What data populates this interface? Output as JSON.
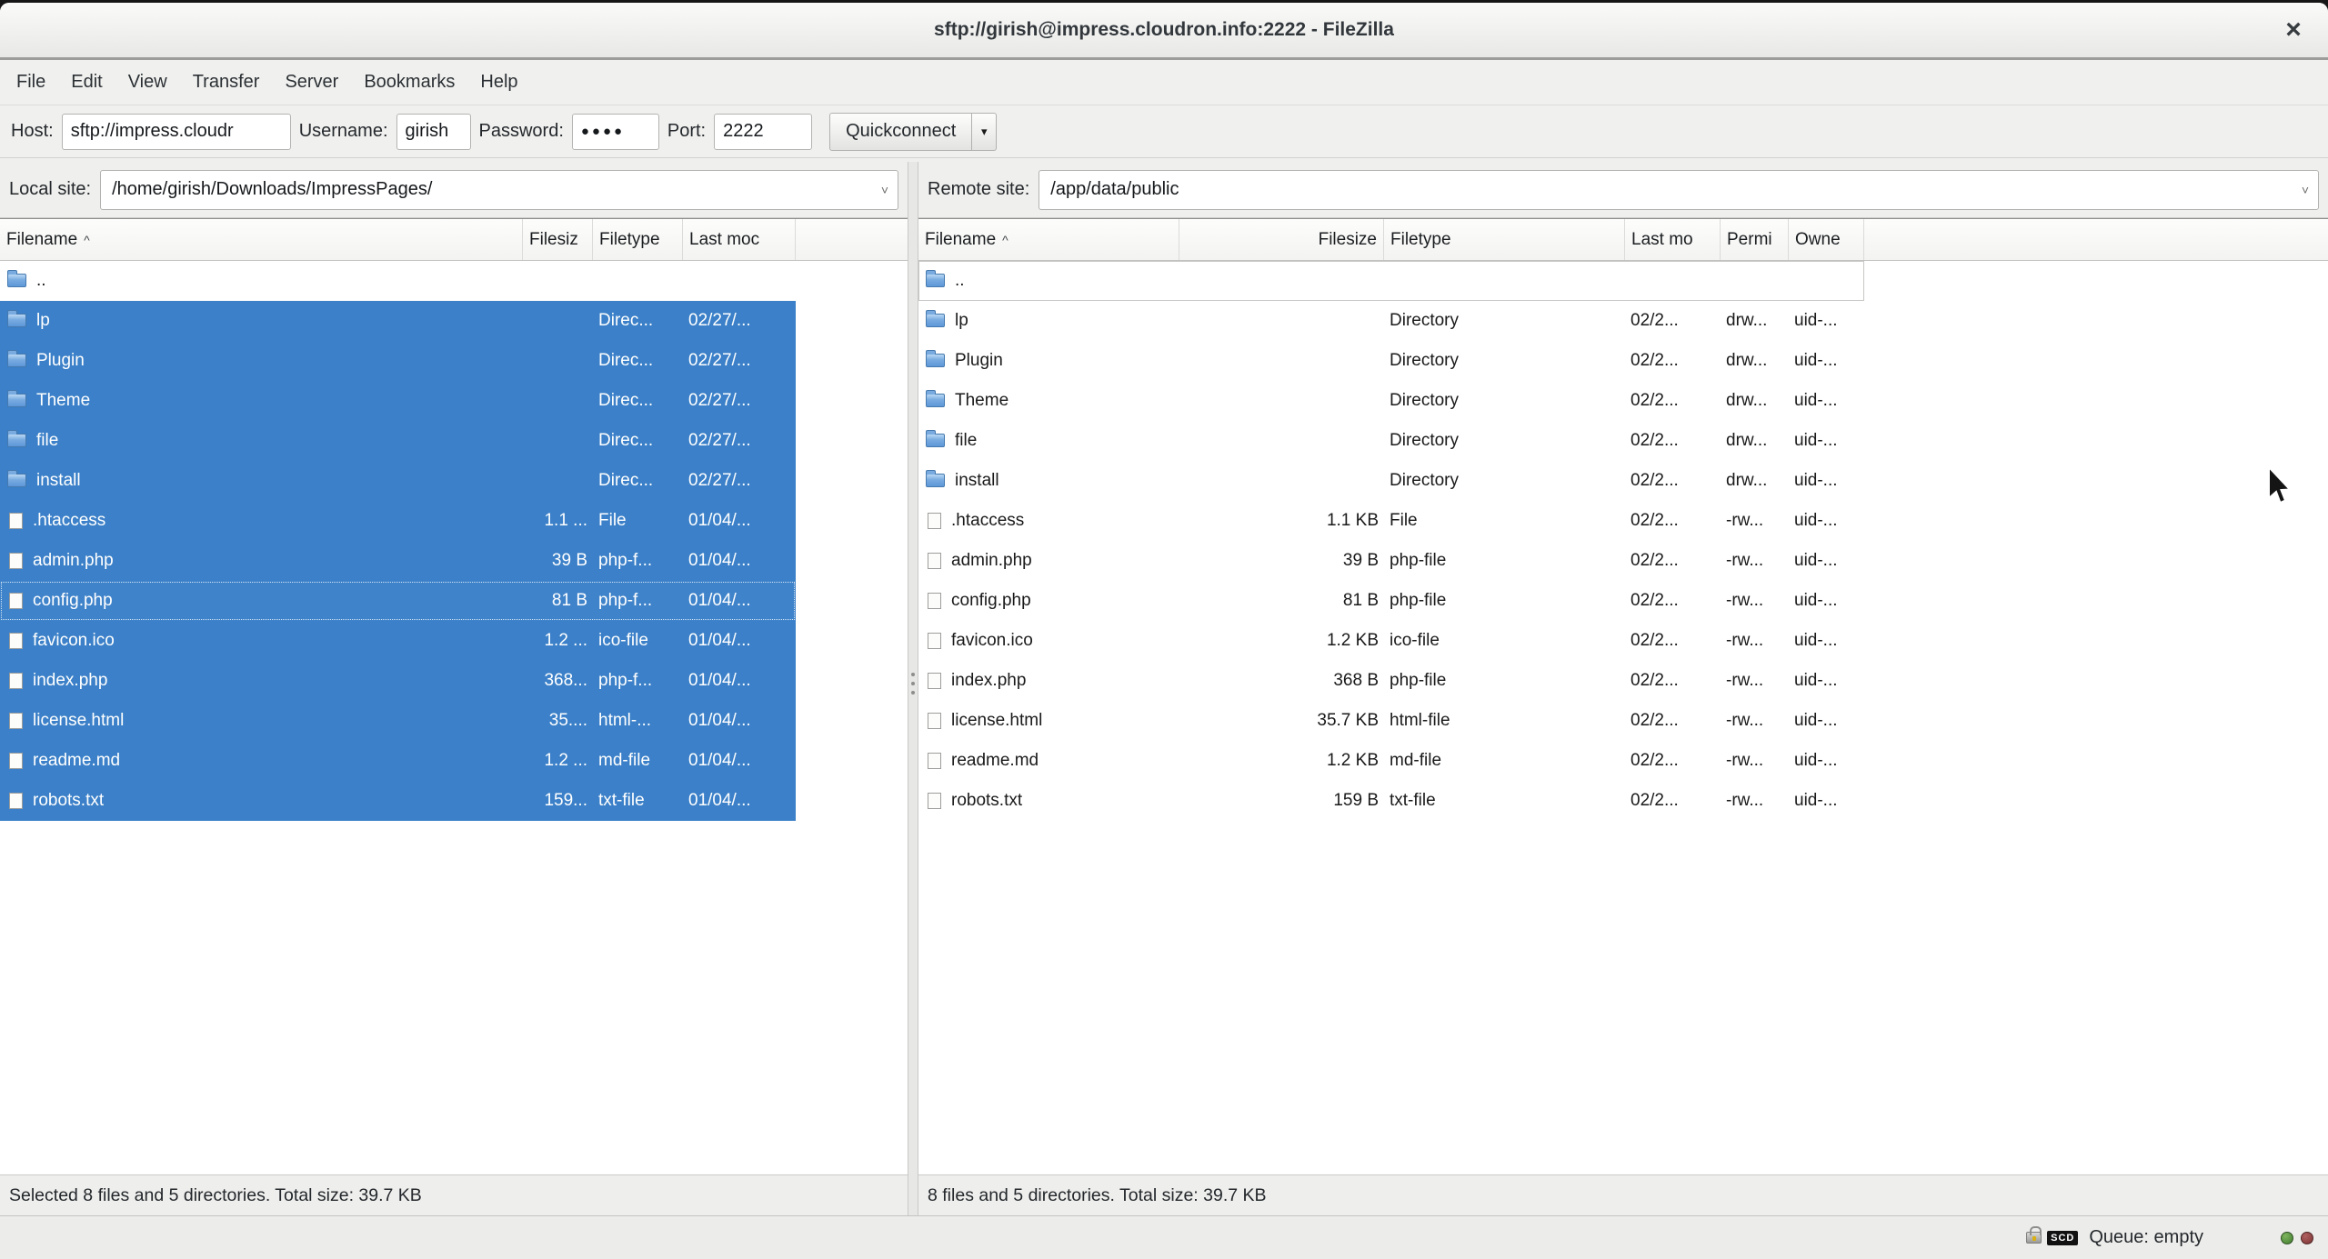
{
  "window": {
    "title": "sftp://girish@impress.cloudron.info:2222 - FileZilla",
    "close_glyph": "×"
  },
  "menubar": {
    "items": [
      "File",
      "Edit",
      "View",
      "Transfer",
      "Server",
      "Bookmarks",
      "Help"
    ]
  },
  "quickconnect": {
    "host_label": "Host:",
    "host_value": "sftp://impress.cloudr",
    "username_label": "Username:",
    "username_value": "girish",
    "password_label": "Password:",
    "password_value": "●●●●",
    "port_label": "Port:",
    "port_value": "2222",
    "button_label": "Quickconnect",
    "dropdown_glyph": "▾"
  },
  "local": {
    "site_label": "Local site:",
    "site_value": "/home/girish/Downloads/ImpressPages/",
    "combo_arrow": "˅",
    "columns": [
      "Filename",
      "Filesiz",
      "Filetype",
      "Last moc"
    ],
    "sort_caret": "^",
    "rows": [
      {
        "name": "..",
        "kind": "dir",
        "size": "",
        "type": "",
        "modified": ""
      },
      {
        "name": "lp",
        "kind": "dir",
        "size": "",
        "type": "Direc...",
        "modified": "02/27/...",
        "selected": true
      },
      {
        "name": "Plugin",
        "kind": "dir",
        "size": "",
        "type": "Direc...",
        "modified": "02/27/...",
        "selected": true
      },
      {
        "name": "Theme",
        "kind": "dir",
        "size": "",
        "type": "Direc...",
        "modified": "02/27/...",
        "selected": true
      },
      {
        "name": "file",
        "kind": "dir",
        "size": "",
        "type": "Direc...",
        "modified": "02/27/...",
        "selected": true
      },
      {
        "name": "install",
        "kind": "dir",
        "size": "",
        "type": "Direc...",
        "modified": "02/27/...",
        "selected": true
      },
      {
        "name": ".htaccess",
        "kind": "file",
        "size": "1.1 ...",
        "type": "File",
        "modified": "01/04/...",
        "selected": true
      },
      {
        "name": "admin.php",
        "kind": "file",
        "size": "39 B",
        "type": "php-f...",
        "modified": "01/04/...",
        "selected": true
      },
      {
        "name": "config.php",
        "kind": "file",
        "size": "81 B",
        "type": "php-f...",
        "modified": "01/04/...",
        "selected": true,
        "focused": true
      },
      {
        "name": "favicon.ico",
        "kind": "file",
        "size": "1.2 ...",
        "type": "ico-file",
        "modified": "01/04/...",
        "selected": true
      },
      {
        "name": "index.php",
        "kind": "file",
        "size": "368...",
        "type": "php-f...",
        "modified": "01/04/...",
        "selected": true
      },
      {
        "name": "license.html",
        "kind": "file",
        "size": "35....",
        "type": "html-...",
        "modified": "01/04/...",
        "selected": true
      },
      {
        "name": "readme.md",
        "kind": "file",
        "size": "1.2 ...",
        "type": "md-file",
        "modified": "01/04/...",
        "selected": true
      },
      {
        "name": "robots.txt",
        "kind": "file",
        "size": "159...",
        "type": "txt-file",
        "modified": "01/04/...",
        "selected": true
      }
    ],
    "status": "Selected 8 files and 5 directories. Total size: 39.7 KB"
  },
  "remote": {
    "site_label": "Remote site:",
    "site_value": "/app/data/public",
    "combo_arrow": "˅",
    "columns": [
      "Filename",
      "Filesize",
      "Filetype",
      "Last mo",
      "Permi",
      "Owne"
    ],
    "sort_caret": "^",
    "rows": [
      {
        "name": "..",
        "kind": "dir",
        "size": "",
        "type": "",
        "modified": "",
        "perms": "",
        "owner": "",
        "focused": true
      },
      {
        "name": "lp",
        "kind": "dir",
        "size": "",
        "type": "Directory",
        "modified": "02/2...",
        "perms": "drw...",
        "owner": "uid-..."
      },
      {
        "name": "Plugin",
        "kind": "dir",
        "size": "",
        "type": "Directory",
        "modified": "02/2...",
        "perms": "drw...",
        "owner": "uid-..."
      },
      {
        "name": "Theme",
        "kind": "dir",
        "size": "",
        "type": "Directory",
        "modified": "02/2...",
        "perms": "drw...",
        "owner": "uid-..."
      },
      {
        "name": "file",
        "kind": "dir",
        "size": "",
        "type": "Directory",
        "modified": "02/2...",
        "perms": "drw...",
        "owner": "uid-..."
      },
      {
        "name": "install",
        "kind": "dir",
        "size": "",
        "type": "Directory",
        "modified": "02/2...",
        "perms": "drw...",
        "owner": "uid-..."
      },
      {
        "name": ".htaccess",
        "kind": "file",
        "size": "1.1 KB",
        "type": "File",
        "modified": "02/2...",
        "perms": "-rw...",
        "owner": "uid-..."
      },
      {
        "name": "admin.php",
        "kind": "file",
        "size": "39 B",
        "type": "php-file",
        "modified": "02/2...",
        "perms": "-rw...",
        "owner": "uid-..."
      },
      {
        "name": "config.php",
        "kind": "file",
        "size": "81 B",
        "type": "php-file",
        "modified": "02/2...",
        "perms": "-rw...",
        "owner": "uid-..."
      },
      {
        "name": "favicon.ico",
        "kind": "file",
        "size": "1.2 KB",
        "type": "ico-file",
        "modified": "02/2...",
        "perms": "-rw...",
        "owner": "uid-..."
      },
      {
        "name": "index.php",
        "kind": "file",
        "size": "368 B",
        "type": "php-file",
        "modified": "02/2...",
        "perms": "-rw...",
        "owner": "uid-..."
      },
      {
        "name": "license.html",
        "kind": "file",
        "size": "35.7 KB",
        "type": "html-file",
        "modified": "02/2...",
        "perms": "-rw...",
        "owner": "uid-..."
      },
      {
        "name": "readme.md",
        "kind": "file",
        "size": "1.2 KB",
        "type": "md-file",
        "modified": "02/2...",
        "perms": "-rw...",
        "owner": "uid-..."
      },
      {
        "name": "robots.txt",
        "kind": "file",
        "size": "159 B",
        "type": "txt-file",
        "modified": "02/2...",
        "perms": "-rw...",
        "owner": "uid-..."
      }
    ],
    "status": "8 files and 5 directories. Total size: 39.7 KB"
  },
  "queuebar": {
    "badge": "SCD",
    "queue_label": "Queue: empty"
  },
  "colors": {
    "selection": "#3b80c8",
    "led_green": "#3f7d2f",
    "led_red": "#7c3434"
  }
}
